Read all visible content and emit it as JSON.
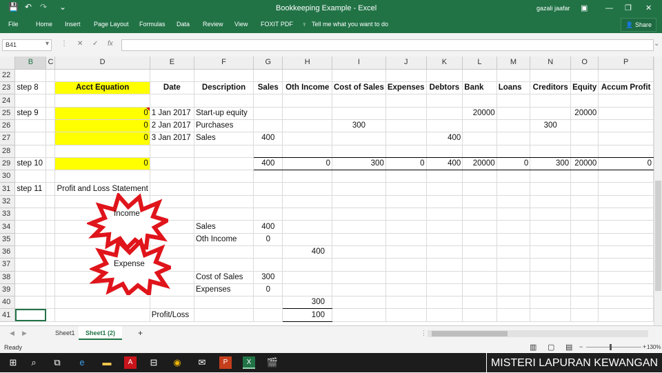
{
  "window": {
    "title": "Bookkeeping Example - Excel",
    "user": "gazali jaafar"
  },
  "qat": {
    "save": "💾",
    "undo": "↶",
    "redo": "↷",
    "more": "⌄"
  },
  "ribbon": {
    "tabs": [
      "File",
      "Home",
      "Insert",
      "Page Layout",
      "Formulas",
      "Data",
      "Review",
      "View",
      "FOXIT PDF"
    ],
    "tell_me": "Tell me what you want to do",
    "share": "Share"
  },
  "formula_bar": {
    "name_box": "B41",
    "fx": "fx",
    "value": ""
  },
  "columns": [
    "",
    "B",
    "C",
    "D",
    "E",
    "F",
    "G",
    "H",
    "I",
    "J",
    "K",
    "L",
    "M",
    "N",
    "O",
    "P"
  ],
  "rows": {
    "r22": {
      "rh": "22"
    },
    "r23": {
      "rh": "23",
      "B": "step 8",
      "D": "Acct Equation",
      "E": "Date",
      "F": "Description",
      "G": "Sales",
      "H": "Oth Income",
      "I": "Cost of Sales",
      "J": "Expenses",
      "K": "Debtors",
      "L": "Bank",
      "M": "Loans",
      "N": "Creditors",
      "O": "Equity",
      "P": "Accum Profit"
    },
    "r24": {
      "rh": "24"
    },
    "r25": {
      "rh": "25",
      "B": "step 9",
      "D": "0",
      "E": "1 Jan 2017",
      "F": "Start-up equity",
      "L": "20000",
      "O": "20000"
    },
    "r26": {
      "rh": "26",
      "D": "0",
      "E": "2 Jan 2017",
      "F": "Purchases",
      "I": "300",
      "N": "300"
    },
    "r27": {
      "rh": "27",
      "D": "0",
      "E": "3 Jan 2017",
      "F": "Sales",
      "G": "400",
      "K": "400"
    },
    "r28": {
      "rh": "28"
    },
    "r29": {
      "rh": "29",
      "B": "step 10",
      "D": "0",
      "G": "400",
      "H": "0",
      "I": "300",
      "J": "0",
      "K": "400",
      "L": "20000",
      "M": "0",
      "N": "300",
      "O": "20000",
      "P": "0"
    },
    "r30": {
      "rh": "30"
    },
    "r31": {
      "rh": "31",
      "B": "step 11",
      "D": "Profit and Loss Statement"
    },
    "r32": {
      "rh": "32"
    },
    "r33": {
      "rh": "33"
    },
    "r34": {
      "rh": "34",
      "F": "Sales",
      "G": "400"
    },
    "r35": {
      "rh": "35",
      "F": "Oth Income",
      "G": "0"
    },
    "r36": {
      "rh": "36",
      "H": "400"
    },
    "r37": {
      "rh": "37"
    },
    "r38": {
      "rh": "38",
      "F": "Cost of Sales",
      "G": "300"
    },
    "r39": {
      "rh": "39",
      "F": "Expenses",
      "G": "0"
    },
    "r40": {
      "rh": "40",
      "H": "300"
    },
    "r41": {
      "rh": "41",
      "E": "Profit/Loss",
      "H": "100"
    }
  },
  "bursts": {
    "income": "Income",
    "expense": "Expense"
  },
  "sheets": {
    "tabs": [
      "Sheet1",
      "Sheet1 (2)"
    ],
    "active": "Sheet1 (2)",
    "add": "+"
  },
  "status": {
    "ready": "Ready",
    "zoom": "130%"
  },
  "taskbar": {
    "items": [
      "windows-icon",
      "search-icon",
      "task-view-icon",
      "edge-icon",
      "file-explorer-icon",
      "acrobat-icon",
      "store-icon",
      "chrome-icon",
      "mail-icon",
      "powerpoint-icon",
      "excel-icon",
      "clapper-icon"
    ]
  },
  "banner": "MISTERI LAPURAN KEWANGAN",
  "colors": {
    "excel_green": "#217346",
    "highlight_yellow": "#ffff00",
    "burst_red": "#e0141b"
  }
}
